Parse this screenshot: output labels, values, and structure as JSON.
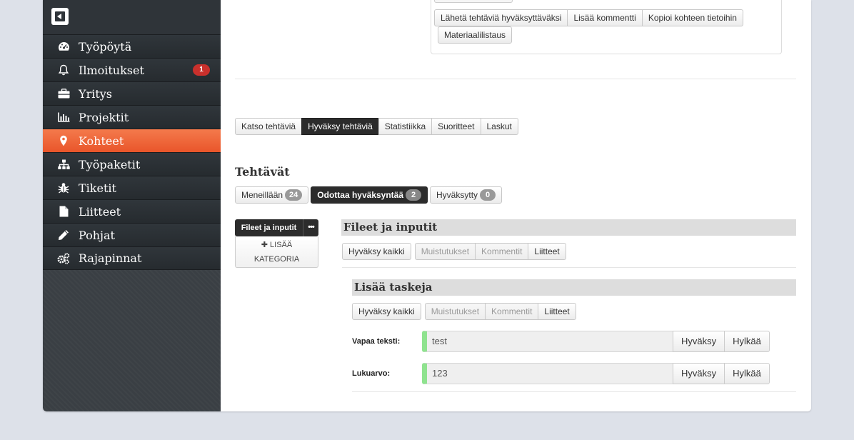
{
  "sidebar": {
    "items": [
      {
        "label": "Työpöytä",
        "icon": "dashboard-icon"
      },
      {
        "label": "Ilmoitukset",
        "icon": "bell-icon",
        "badge": "1"
      },
      {
        "label": "Yritys",
        "icon": "briefcase-icon"
      },
      {
        "label": "Projektit",
        "icon": "bar-chart-icon"
      },
      {
        "label": "Kohteet",
        "icon": "map-marker-icon",
        "active": true
      },
      {
        "label": "Työpaketit",
        "icon": "sitemap-icon"
      },
      {
        "label": "Tiketit",
        "icon": "bug-icon"
      },
      {
        "label": "Liitteet",
        "icon": "file-icon"
      },
      {
        "label": "Pohjat",
        "icon": "pencil-icon"
      },
      {
        "label": "Rajapinnat",
        "icon": "gears-icon"
      }
    ]
  },
  "top_actions": {
    "send_approval": "Lähetä tehtäviä hyväksyttäväksi",
    "add_comment": "Lisää kommentti",
    "copy_to_info": "Kopioi kohteen tietoihin",
    "material_list": "Materiaalilistaus"
  },
  "tabs": [
    "Katso tehtäviä",
    "Hyväksy tehtäviä",
    "Statistiikka",
    "Suoritteet",
    "Laskut"
  ],
  "active_tab": "Hyväksy tehtäviä",
  "tasks": {
    "title": "Tehtävät",
    "filters": [
      {
        "label": "Meneillään",
        "count": "24"
      },
      {
        "label": "Odottaa hyväksyntää",
        "count": "2"
      },
      {
        "label": "Hyväksytty",
        "count": "0"
      }
    ]
  },
  "category": {
    "active": "Fileet ja inputit",
    "more": "•••",
    "add_line1": "LISÄÄ",
    "add_line2": "KATEGORIA",
    "add_prefix": "✚"
  },
  "panel": {
    "title": "Fileet ja inputit",
    "approve_all": "Hyväksy kaikki",
    "filters": [
      "Muistutukset",
      "Kommentit",
      "Liitteet"
    ]
  },
  "subpanel": {
    "title": "Lisää taskeja",
    "approve_all": "Hyväksy kaikki",
    "filters": [
      "Muistutukset",
      "Kommentit",
      "Liitteet"
    ],
    "fields": [
      {
        "label": "Vapaa teksti:",
        "value": "test",
        "approve": "Hyväksy",
        "reject": "Hylkää"
      },
      {
        "label": "Lukuarvo:",
        "value": "123",
        "approve": "Hyväksy",
        "reject": "Hylkää"
      }
    ]
  },
  "colors": {
    "accent": "#ef6a3c",
    "sidebar": "#2b3035",
    "badge": "#c9302c",
    "field_marker": "#8fe38f"
  }
}
